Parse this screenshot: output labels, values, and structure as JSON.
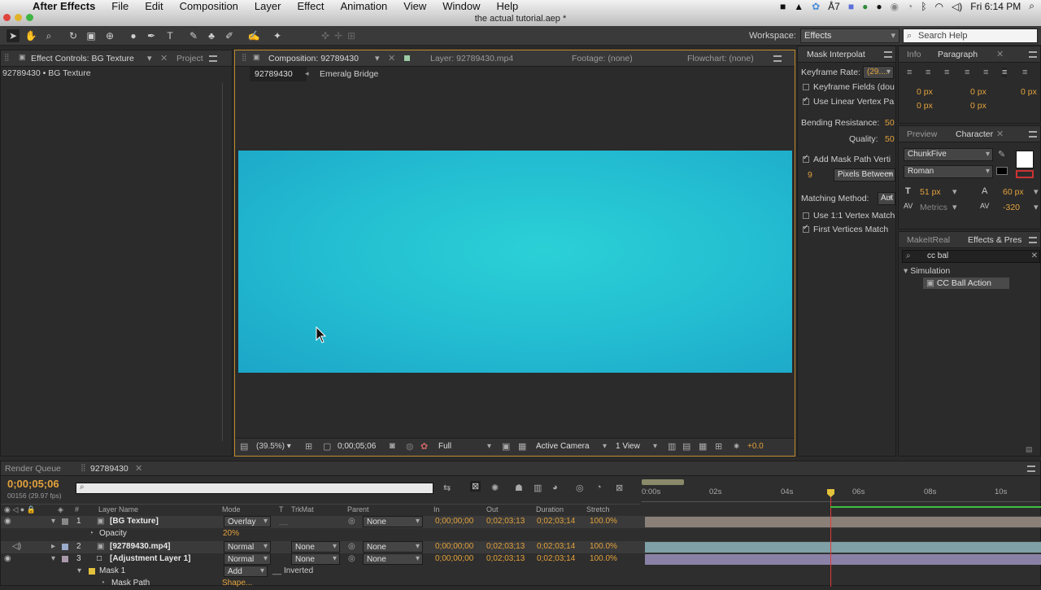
{
  "menubar": {
    "app_name": "After Effects",
    "items": [
      "File",
      "Edit",
      "Composition",
      "Layer",
      "Effect",
      "Animation",
      "View",
      "Window",
      "Help"
    ],
    "clock": "Fri 6:14 PM",
    "adobe_badge": "7"
  },
  "window_title": "the actual tutorial.aep *",
  "toolbar": {
    "workspace_label": "Workspace:",
    "workspace_value": "Effects",
    "search_help_placeholder": "Search Help"
  },
  "effect_controls": {
    "tab_label": "Effect Controls: BG Texture",
    "tab_project": "Project",
    "breadcrumb": "92789430 • BG Texture"
  },
  "composition": {
    "tab_label": "Composition: 92789430",
    "tab_layer": "Layer: 92789430.mp4",
    "tab_footage": "Footage: (none)",
    "tab_flowchart": "Flowchart: (none)",
    "comp_button": "92789430",
    "nav_item": "Emeralg Bridge",
    "canvas_color": "#24c0d2",
    "bottom": {
      "zoom": "(39.5%)",
      "timecode": "0;00;05;06",
      "resolution": "Full",
      "camera": "Active Camera",
      "views": "1 View",
      "exposure": "+0.0"
    }
  },
  "mask_interpolation": {
    "tab_label": "Mask Interpolat",
    "keyframe_rate_label": "Keyframe Rate:",
    "keyframe_rate_value": "(29....",
    "keyframe_fields": "Keyframe Fields (dou",
    "use_linear": "Use Linear Vertex Pa",
    "bending_label": "Bending Resistance:",
    "bending_value": "50",
    "quality_label": "Quality:",
    "quality_value": "50",
    "add_mask_path": "Add Mask Path Verti",
    "pixels_value": "9",
    "pixels_between": "Pixels Between",
    "matching_label": "Matching Method:",
    "matching_value": "Aut",
    "use_1to1": "Use 1:1 Vertex Match",
    "first_vertices": "First Vertices Match"
  },
  "paragraph": {
    "tab_info": "Info",
    "tab_paragraph": "Paragraph",
    "indent_values": [
      "0 px",
      "0 px",
      "0 px",
      "0 px",
      "0 px"
    ]
  },
  "character": {
    "tab_preview": "Preview",
    "tab_character": "Character",
    "font_family": "ChunkFive",
    "font_style": "Roman",
    "font_size": "51 px",
    "leading": "60 px",
    "kerning": "Metrics",
    "tracking": "-320"
  },
  "effects_presets": {
    "tab_makeitreal": "MakeItReal",
    "tab_effects": "Effects & Pres",
    "search_value": "cc bal",
    "category": "Simulation",
    "item": "CC Ball Action"
  },
  "timeline": {
    "tab_render_queue": "Render Queue",
    "tab_comp": "92789430",
    "current_time": "0;00;05;06",
    "frame_info": "00156 (29.97 fps)",
    "headers": {
      "layer_name": "Layer Name",
      "mode": "Mode",
      "t": "T",
      "trkmat": "TrkMat",
      "parent": "Parent",
      "in": "In",
      "out": "Out",
      "duration": "Duration",
      "stretch": "Stretch"
    },
    "ruler": [
      "0:00s",
      "02s",
      "04s",
      "06s",
      "08s",
      "10s"
    ],
    "layers": [
      {
        "num": "1",
        "name": "[BG Texture]",
        "mode": "Overlay",
        "trkmat": "",
        "parent": "None",
        "in": "0;00;00;00",
        "out": "0;02;03;13",
        "duration": "0;02;03;14",
        "stretch": "100.0%"
      },
      {
        "num": "2",
        "name": "[92789430.mp4]",
        "mode": "Normal",
        "trkmat": "None",
        "parent": "None",
        "in": "0;00;00;00",
        "out": "0;02;03;13",
        "duration": "0;02;03;14",
        "stretch": "100.0%"
      },
      {
        "num": "3",
        "name": "[Adjustment Layer 1]",
        "mode": "Normal",
        "trkmat": "None",
        "parent": "None",
        "in": "0;00;00;00",
        "out": "0;02;03;13",
        "duration": "0;02;03;14",
        "stretch": "100.0%"
      }
    ],
    "opacity_label": "Opacity",
    "opacity_value": "20%",
    "mask_label": "Mask 1",
    "mask_mode": "Add",
    "mask_inverted": "Inverted",
    "mask_path": "Mask Path",
    "mask_path_value": "Shape..."
  }
}
